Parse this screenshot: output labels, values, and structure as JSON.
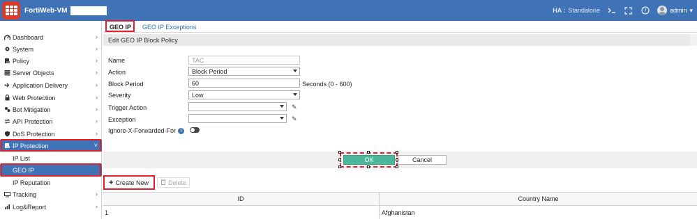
{
  "topbar": {
    "product": "FortiWeb-VM",
    "ha_label": "HA :",
    "ha_value": "Standalone",
    "user": "admin",
    "icons": [
      "cli-console-icon",
      "fullscreen-icon",
      "help-icon",
      "user-avatar-icon"
    ]
  },
  "sidebar": {
    "items": [
      {
        "label": "Dashboard",
        "icon": "dashboard-icon"
      },
      {
        "label": "System",
        "icon": "gear-icon"
      },
      {
        "label": "Policy",
        "icon": "policy-icon"
      },
      {
        "label": "Server Objects",
        "icon": "server-icon"
      },
      {
        "label": "Application Delivery",
        "icon": "delivery-icon"
      },
      {
        "label": "Web Protection",
        "icon": "lock-icon"
      },
      {
        "label": "Bot Mitigation",
        "icon": "bot-icon"
      },
      {
        "label": "API Protection",
        "icon": "api-icon"
      },
      {
        "label": "DoS Protection",
        "icon": "shield-icon"
      },
      {
        "label": "IP Protection",
        "icon": "ip-protection-icon"
      },
      {
        "label": "IP List",
        "icon": ""
      },
      {
        "label": "GEO IP",
        "icon": ""
      },
      {
        "label": "IP Reputation",
        "icon": ""
      },
      {
        "label": "Tracking",
        "icon": "tracking-icon"
      },
      {
        "label": "Log&Report",
        "icon": "report-icon"
      }
    ]
  },
  "tabs": [
    {
      "label": "GEO IP"
    },
    {
      "label": "GEO IP Exceptions"
    }
  ],
  "panel": {
    "title": "Edit GEO IP Block Policy"
  },
  "form": {
    "name_label": "Name",
    "name_value": "TAC",
    "action_label": "Action",
    "action_value": "Block Period",
    "block_period_label": "Block Period",
    "block_period_value": "60",
    "block_period_hint": "Seconds (0 - 600)",
    "severity_label": "Severity",
    "severity_value": "Low",
    "trigger_label": "Trigger Action",
    "trigger_value": "",
    "exception_label": "Exception",
    "exception_value": "",
    "ignore_xff_label": "Ignore-X-Forwarded-For",
    "ignore_xff_enabled": false
  },
  "buttons": {
    "ok": "OK",
    "cancel": "Cancel",
    "create_new": "Create New",
    "delete": "Delete"
  },
  "table": {
    "columns": [
      "ID",
      "Country Name"
    ],
    "rows": [
      {
        "id": "1",
        "country": "Afghanistan"
      }
    ]
  },
  "colors": {
    "brand": "#3f73b5",
    "ok_button": "#4cb89b",
    "highlight": "#e2202b"
  }
}
